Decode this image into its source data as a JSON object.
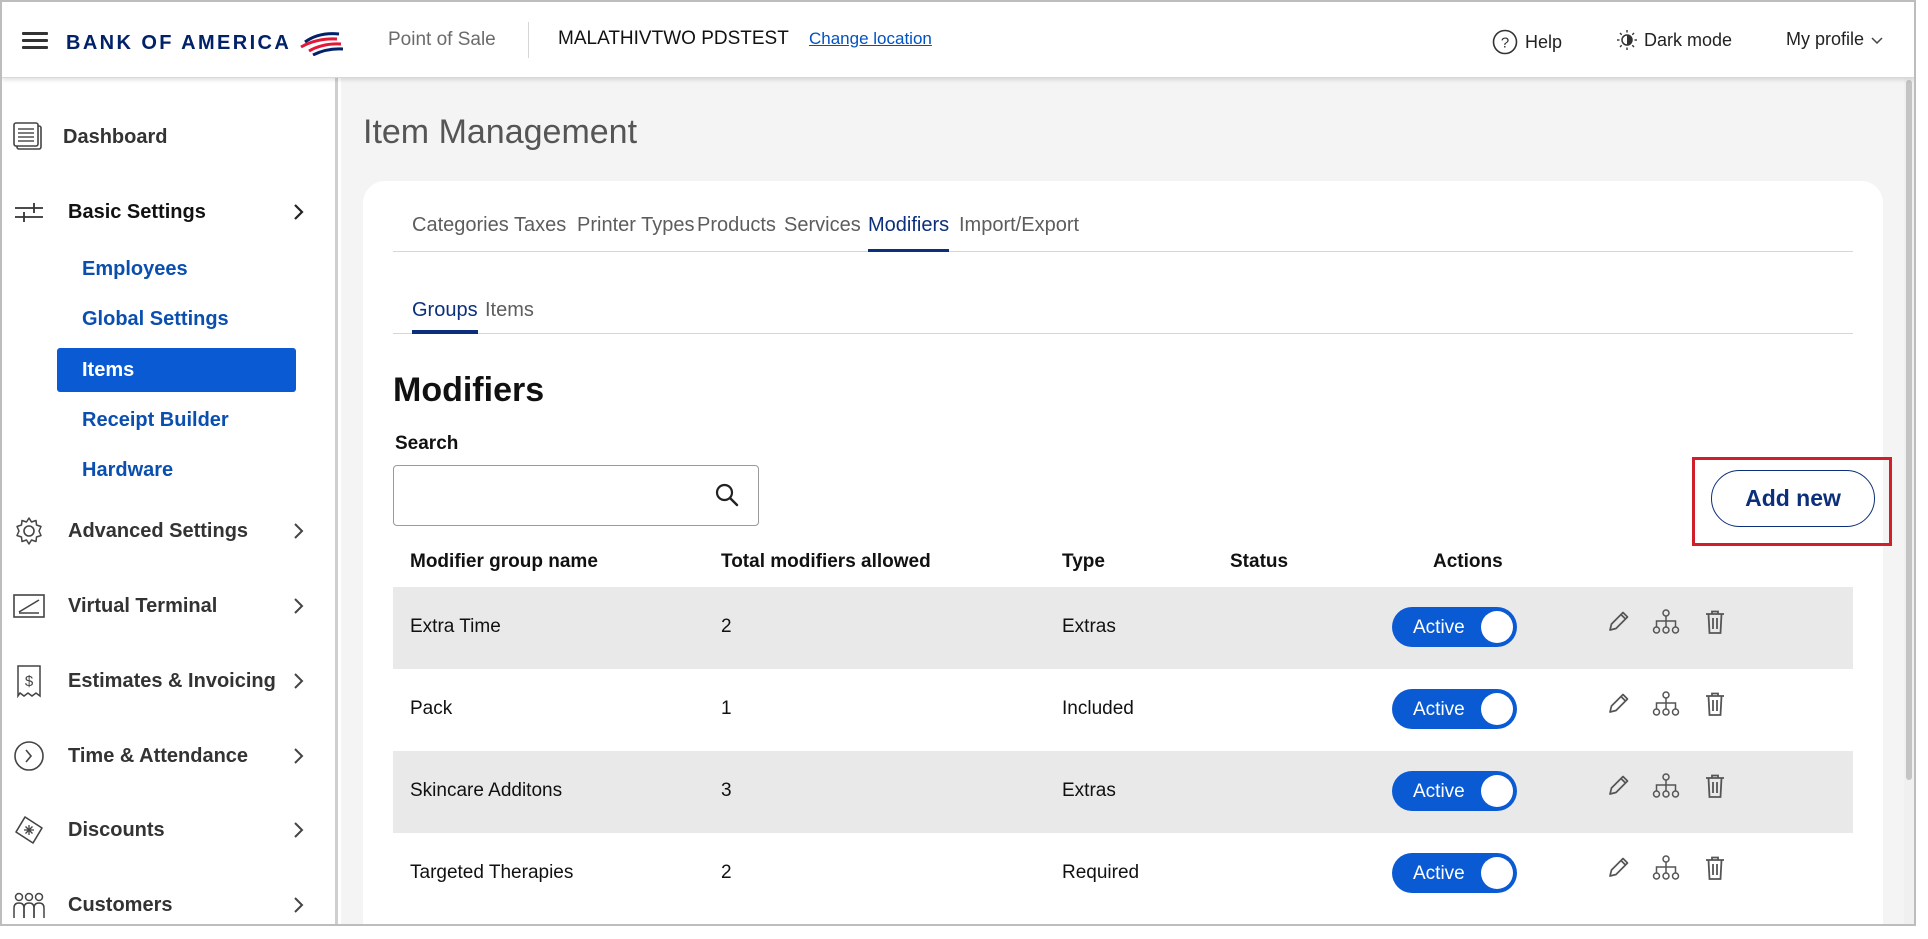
{
  "header": {
    "brand": "BANK OF AMERICA",
    "app_name": "Point of Sale",
    "merchant": "MALATHIVTWO PDSTEST",
    "change_location": "Change location",
    "help": "Help",
    "dark_mode": "Dark mode",
    "profile": "My profile"
  },
  "sidebar": {
    "items": [
      {
        "label": "Dashboard",
        "icon": "dashboard-icon"
      },
      {
        "label": "Basic Settings",
        "icon": "sliders-icon"
      },
      {
        "label": "Advanced Settings",
        "icon": "gear-icon"
      },
      {
        "label": "Virtual Terminal",
        "icon": "terminal-icon"
      },
      {
        "label": "Estimates & Invoicing",
        "icon": "invoice-icon"
      },
      {
        "label": "Time & Attendance",
        "icon": "clock-icon"
      },
      {
        "label": "Discounts",
        "icon": "discount-tag-icon"
      },
      {
        "label": "Customers",
        "icon": "customers-icon"
      }
    ],
    "sub_items": [
      "Employees",
      "Global Settings",
      "Items",
      "Receipt Builder",
      "Hardware"
    ],
    "active_sub": "Items"
  },
  "main": {
    "page_title": "Item Management",
    "tabs": [
      "Categories",
      "Taxes",
      "Printer Types",
      "Products",
      "Services",
      "Modifiers",
      "Import/Export"
    ],
    "active_tab": "Modifiers",
    "subtabs": [
      "Groups",
      "Items"
    ],
    "active_subtab": "Groups",
    "section_title": "Modifiers",
    "search_label": "Search",
    "search_value": "",
    "add_button": "Add new",
    "table": {
      "headers": [
        "Modifier group name",
        "Total modifiers allowed",
        "Type",
        "Status",
        "Actions"
      ],
      "rows": [
        {
          "name": "Extra Time",
          "total": "2",
          "type": "Extras",
          "status": "Active"
        },
        {
          "name": "Pack",
          "total": "1",
          "type": "Included",
          "status": "Active"
        },
        {
          "name": "Skincare Additons",
          "total": "3",
          "type": "Extras",
          "status": "Active"
        },
        {
          "name": "Targeted Therapies",
          "total": "2",
          "type": "Required",
          "status": "Active"
        }
      ]
    }
  },
  "colors": {
    "brand_navy": "#012169",
    "brand_red": "#e31837",
    "accent_blue": "#0a5ad4",
    "highlight_red": "#d01e2b"
  }
}
